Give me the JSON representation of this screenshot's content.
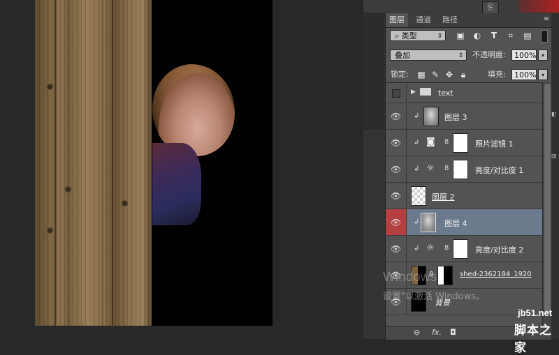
{
  "panel": {
    "tabs": [
      {
        "label": "图层",
        "active": true
      },
      {
        "label": "通道",
        "active": false
      },
      {
        "label": "路径",
        "active": false
      }
    ],
    "menu_icon": "≡",
    "filter_kind": "类型",
    "filter_icons": [
      "image-filter-icon",
      "adjustment-filter-icon",
      "type-filter-icon",
      "shape-filter-icon",
      "smart-object-filter-icon"
    ],
    "type_icon_glyph": "T",
    "blend_mode": "叠加",
    "opacity_label": "不透明度:",
    "opacity_value": "100%",
    "lock_label": "锁定:",
    "fill_label": "填充:",
    "fill_value": "100%"
  },
  "layers": [
    {
      "name": "text",
      "kind": "group",
      "visible": false,
      "selected": false
    },
    {
      "name": "图层 3",
      "kind": "pixel",
      "visible": true,
      "clipped": true,
      "selected": false
    },
    {
      "name": "照片滤镜 1",
      "kind": "adjustment",
      "visible": true,
      "clipped": true,
      "selected": false
    },
    {
      "name": "亮度/对比度 1",
      "kind": "adjustment",
      "visible": true,
      "clipped": true,
      "selected": false
    },
    {
      "name": "图层 2",
      "kind": "pixel",
      "visible": true,
      "clipped": false,
      "selected": false
    },
    {
      "name": "图层 4",
      "kind": "pixel",
      "visible": true,
      "clipped": true,
      "selected": true
    },
    {
      "name": "亮度/对比度 2",
      "kind": "adjustment",
      "visible": true,
      "clipped": true,
      "selected": false
    },
    {
      "name": "shed-2362184_1920",
      "kind": "masked",
      "visible": true,
      "clipped": false,
      "selected": false
    },
    {
      "name": "背景",
      "kind": "background",
      "visible": true,
      "clipped": false,
      "selected": false
    }
  ],
  "footer": {
    "link_icon": "⊖",
    "fx_label": "fx."
  },
  "watermark": {
    "line1": "Windows",
    "line2": "设置\"以激活 Windows。"
  },
  "site": {
    "url": "jb51.net",
    "name": "脚本之家"
  },
  "colors": {
    "selected_row": "#6c7a8e",
    "eye_highlight": "#b64041",
    "panel_bg": "#535353"
  }
}
